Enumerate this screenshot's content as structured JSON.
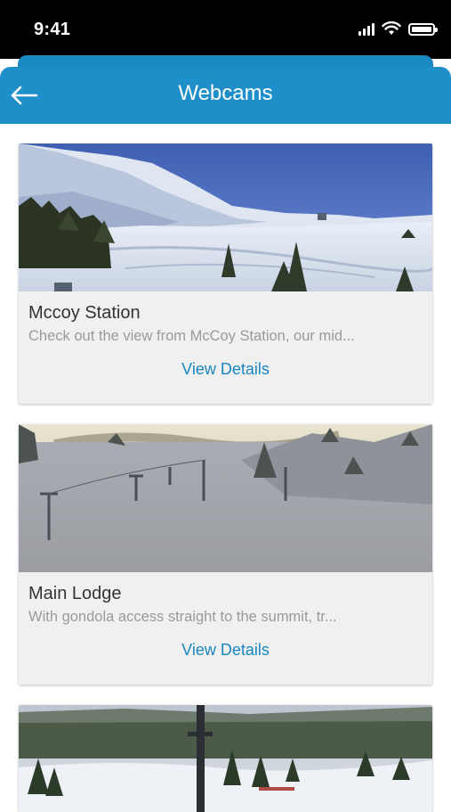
{
  "status_bar": {
    "time": "9:41"
  },
  "header": {
    "title": "Webcams"
  },
  "webcams": [
    {
      "title": "Mccoy Station",
      "description": "Check out the view from McCoy Station, our mid...",
      "link_label": "View Details"
    },
    {
      "title": "Main Lodge",
      "description": "With gondola access straight to the summit, tr...",
      "link_label": "View Details"
    }
  ],
  "colors": {
    "header": "#1f8fca",
    "link": "#1a86c0",
    "card_bg": "#f0f0f0"
  }
}
